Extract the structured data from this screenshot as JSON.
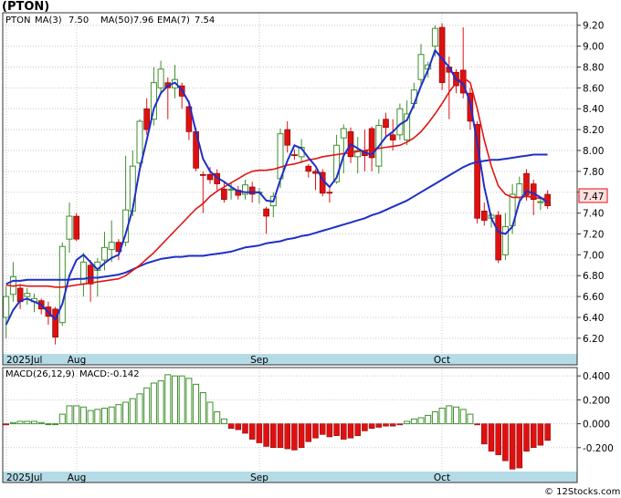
{
  "title": "(PTON)",
  "legend": {
    "ticker": "PTON",
    "ma3_label": "MA(3)",
    "ma3_value": "7.50",
    "ma50_label": "MA(50)",
    "ma50_value": "7.96",
    "ema7_label": "EMA(7)",
    "ema7_value": "7.54"
  },
  "macd_legend": {
    "label": "MACD(26,12,9)",
    "value_label": "MACD:-0.142"
  },
  "last_price_tag": "7.47",
  "credit": "© 12Stocks.com",
  "colors": {
    "up": "#3f8f2c",
    "down": "#e01010",
    "ma_blue": "#1f2fc8",
    "ma_red": "#e01414",
    "axis_band": "#b5dbe6",
    "grid": "#c8c8c8",
    "price_tag_bg": "#ffdede"
  },
  "chart_data": [
    {
      "type": "candlestick",
      "x_tick_labels": [
        "2025Jul",
        "Aug",
        "Sep",
        "Oct"
      ],
      "y_ticks": [
        "6.20",
        "6.40",
        "6.60",
        "6.80",
        "7.00",
        "7.20",
        "7.40",
        "7.60",
        "7.80",
        "8.00",
        "8.20",
        "8.40",
        "8.60",
        "8.80",
        "9.00",
        "9.20"
      ],
      "ylim": [
        6.05,
        9.32
      ],
      "grid": true,
      "candles": [
        [
          6.4,
          6.6,
          6.7,
          6.2
        ],
        [
          6.62,
          6.79,
          6.93,
          6.55
        ],
        [
          6.68,
          6.55,
          6.72,
          6.48
        ],
        [
          6.6,
          6.63,
          6.68,
          6.52
        ],
        [
          6.55,
          6.58,
          6.63,
          6.45
        ],
        [
          6.56,
          6.48,
          6.58,
          6.43
        ],
        [
          6.5,
          6.41,
          6.55,
          6.33
        ],
        [
          6.48,
          6.21,
          6.5,
          6.14
        ],
        [
          6.35,
          7.08,
          7.12,
          6.32
        ],
        [
          7.15,
          7.37,
          7.5,
          7.02
        ],
        [
          7.37,
          7.15,
          7.4,
          7.13
        ],
        [
          6.72,
          6.93,
          7.02,
          6.6
        ],
        [
          6.9,
          6.72,
          6.95,
          6.55
        ],
        [
          6.85,
          6.93,
          6.97,
          6.6
        ],
        [
          6.95,
          7.07,
          7.22,
          6.85
        ],
        [
          7.05,
          7.12,
          7.33,
          6.93
        ],
        [
          7.12,
          7.03,
          7.15,
          6.95
        ],
        [
          7.12,
          7.43,
          7.95,
          7.08
        ],
        [
          7.42,
          7.85,
          8.0,
          7.37
        ],
        [
          7.88,
          8.28,
          8.3,
          7.83
        ],
        [
          8.4,
          8.2,
          8.5,
          8.15
        ],
        [
          8.3,
          8.65,
          8.8,
          8.24
        ],
        [
          8.6,
          8.78,
          8.86,
          8.55
        ],
        [
          8.65,
          8.6,
          8.7,
          8.3
        ],
        [
          8.6,
          8.68,
          8.82,
          8.5
        ],
        [
          8.62,
          8.52,
          8.65,
          8.4
        ],
        [
          8.42,
          8.18,
          8.48,
          8.1
        ],
        [
          8.18,
          7.83,
          8.22,
          7.8
        ],
        [
          7.77,
          7.76,
          7.8,
          7.4
        ],
        [
          7.77,
          7.72,
          7.84,
          7.68
        ],
        [
          7.78,
          7.68,
          7.82,
          7.62
        ],
        [
          7.63,
          7.53,
          7.69,
          7.5
        ],
        [
          7.62,
          7.63,
          7.69,
          7.53
        ],
        [
          7.62,
          7.57,
          7.66,
          7.53
        ],
        [
          7.58,
          7.67,
          7.72,
          7.53
        ],
        [
          7.65,
          7.58,
          7.7,
          7.5
        ],
        [
          7.6,
          7.6,
          7.64,
          7.49
        ],
        [
          7.44,
          7.37,
          7.46,
          7.2
        ],
        [
          7.47,
          7.56,
          7.6,
          7.36
        ],
        [
          7.73,
          8.16,
          8.21,
          7.64
        ],
        [
          8.2,
          8.05,
          8.28,
          7.98
        ],
        [
          7.96,
          7.95,
          8.01,
          7.91
        ],
        [
          7.94,
          8.03,
          8.11,
          7.88
        ],
        [
          7.85,
          7.8,
          7.87,
          7.74
        ],
        [
          7.8,
          7.78,
          7.82,
          7.62
        ],
        [
          7.79,
          7.59,
          7.82,
          7.56
        ],
        [
          7.6,
          7.59,
          7.64,
          7.5
        ],
        [
          7.7,
          8.05,
          8.15,
          7.68
        ],
        [
          8.12,
          8.21,
          8.25,
          7.78
        ],
        [
          8.18,
          7.94,
          8.22,
          7.88
        ],
        [
          7.94,
          8.0,
          8.13,
          7.78
        ],
        [
          8.0,
          7.95,
          8.2,
          7.8
        ],
        [
          8.21,
          7.93,
          8.23,
          7.8
        ],
        [
          7.85,
          8.24,
          8.3,
          7.78
        ],
        [
          8.3,
          8.22,
          8.36,
          8.14
        ],
        [
          8.15,
          8.1,
          8.3,
          8.0
        ],
        [
          8.15,
          8.4,
          8.45,
          8.1
        ],
        [
          8.1,
          8.35,
          8.48,
          8.05
        ],
        [
          8.45,
          8.58,
          8.65,
          8.4
        ],
        [
          8.68,
          8.92,
          9.02,
          8.62
        ],
        [
          8.78,
          8.82,
          8.85,
          8.7
        ],
        [
          9.0,
          9.17,
          9.2,
          8.9
        ],
        [
          9.18,
          8.65,
          9.22,
          8.58
        ],
        [
          8.8,
          8.75,
          8.9,
          8.3
        ],
        [
          8.75,
          8.62,
          8.78,
          8.55
        ],
        [
          8.77,
          8.55,
          9.18,
          8.5
        ],
        [
          8.55,
          8.28,
          8.6,
          8.2
        ],
        [
          8.25,
          7.35,
          8.28,
          7.3
        ],
        [
          7.42,
          7.33,
          7.5,
          7.28
        ],
        [
          7.35,
          7.38,
          7.4,
          7.26
        ],
        [
          7.38,
          6.95,
          7.42,
          6.92
        ],
        [
          7.0,
          7.27,
          7.4,
          6.95
        ],
        [
          7.28,
          7.58,
          7.68,
          7.2
        ],
        [
          7.55,
          7.68,
          7.75,
          7.5
        ],
        [
          7.78,
          7.57,
          7.82,
          7.52
        ],
        [
          7.68,
          7.53,
          7.72,
          7.38
        ],
        [
          7.5,
          7.51,
          7.54,
          7.43
        ],
        [
          7.58,
          7.47,
          7.62,
          7.44
        ]
      ],
      "ma3": [
        6.33,
        6.47,
        6.56,
        6.58,
        6.55,
        6.52,
        6.45,
        6.38,
        6.53,
        6.8,
        6.95,
        7.0,
        6.93,
        6.86,
        6.92,
        6.97,
        7.0,
        7.2,
        7.44,
        7.82,
        8.1,
        8.4,
        8.55,
        8.62,
        8.65,
        8.58,
        8.46,
        8.18,
        7.92,
        7.8,
        7.74,
        7.7,
        7.65,
        7.61,
        7.6,
        7.6,
        7.6,
        7.52,
        7.51,
        7.72,
        7.9,
        8.05,
        8.02,
        7.93,
        7.85,
        7.72,
        7.65,
        7.74,
        7.95,
        8.06,
        8.02,
        7.98,
        7.96,
        8.04,
        8.13,
        8.18,
        8.25,
        8.29,
        8.44,
        8.62,
        8.77,
        8.96,
        8.88,
        8.8,
        8.68,
        8.64,
        8.46,
        8.07,
        7.65,
        7.35,
        7.22,
        7.2,
        7.27,
        7.51,
        7.61,
        7.59,
        7.55,
        7.5
      ],
      "ema7": [
        6.71,
        6.7,
        6.71,
        6.7,
        6.7,
        6.7,
        6.7,
        6.69,
        6.69,
        6.7,
        6.71,
        6.72,
        6.73,
        6.74,
        6.75,
        6.76,
        6.77,
        6.8,
        6.85,
        6.9,
        6.96,
        7.02,
        7.09,
        7.16,
        7.23,
        7.3,
        7.37,
        7.44,
        7.49,
        7.56,
        7.61,
        7.65,
        7.69,
        7.73,
        7.77,
        7.8,
        7.81,
        7.81,
        7.82,
        7.84,
        7.86,
        7.87,
        7.89,
        7.91,
        7.92,
        7.94,
        7.95,
        7.96,
        7.97,
        7.98,
        7.99,
        8.0,
        8.01,
        8.02,
        8.03,
        8.04,
        8.05,
        8.08,
        8.12,
        8.18,
        8.26,
        8.35,
        8.45,
        8.56,
        8.65,
        8.7,
        8.65,
        8.4,
        8.1,
        7.85,
        7.66,
        7.58,
        7.55,
        7.55,
        7.56,
        7.55,
        7.54,
        7.54
      ],
      "ma50": [
        6.72,
        6.75,
        6.75,
        6.76,
        6.76,
        6.76,
        6.76,
        6.76,
        6.76,
        6.76,
        6.77,
        6.77,
        6.78,
        6.78,
        6.79,
        6.8,
        6.81,
        6.83,
        6.86,
        6.89,
        6.92,
        6.94,
        6.96,
        6.97,
        6.98,
        6.98,
        6.99,
        6.99,
        6.99,
        7.0,
        7.01,
        7.02,
        7.03,
        7.05,
        7.07,
        7.08,
        7.09,
        7.11,
        7.12,
        7.13,
        7.15,
        7.16,
        7.18,
        7.19,
        7.21,
        7.23,
        7.25,
        7.27,
        7.29,
        7.31,
        7.33,
        7.35,
        7.38,
        7.4,
        7.43,
        7.46,
        7.49,
        7.52,
        7.56,
        7.6,
        7.64,
        7.68,
        7.72,
        7.76,
        7.8,
        7.84,
        7.87,
        7.89,
        7.9,
        7.91,
        7.91,
        7.92,
        7.93,
        7.94,
        7.95,
        7.96,
        7.96,
        7.96
      ]
    },
    {
      "type": "bar",
      "name": "MACD(26,12,9)",
      "y_ticks": [
        "0.400",
        "0.200",
        "0.000",
        "-0.200"
      ],
      "ylim": [
        -0.4,
        0.47
      ],
      "values": [
        -0.01,
        0.01,
        0.02,
        0.02,
        0.02,
        0.01,
        0.0,
        0.0,
        0.08,
        0.15,
        0.15,
        0.14,
        0.11,
        0.12,
        0.13,
        0.14,
        0.16,
        0.18,
        0.21,
        0.25,
        0.3,
        0.34,
        0.36,
        0.41,
        0.4,
        0.4,
        0.38,
        0.33,
        0.26,
        0.18,
        0.1,
        0.04,
        -0.04,
        -0.05,
        -0.08,
        -0.13,
        -0.16,
        -0.19,
        -0.2,
        -0.2,
        -0.21,
        -0.22,
        -0.2,
        -0.15,
        -0.12,
        -0.09,
        -0.11,
        -0.1,
        -0.13,
        -0.12,
        -0.1,
        -0.06,
        -0.04,
        -0.03,
        -0.02,
        -0.02,
        -0.01,
        0.02,
        0.04,
        0.05,
        0.07,
        0.1,
        0.13,
        0.15,
        0.14,
        0.12,
        0.08,
        -0.01,
        -0.17,
        -0.23,
        -0.26,
        -0.31,
        -0.38,
        -0.37,
        -0.23,
        -0.2,
        -0.18,
        -0.14
      ]
    }
  ]
}
